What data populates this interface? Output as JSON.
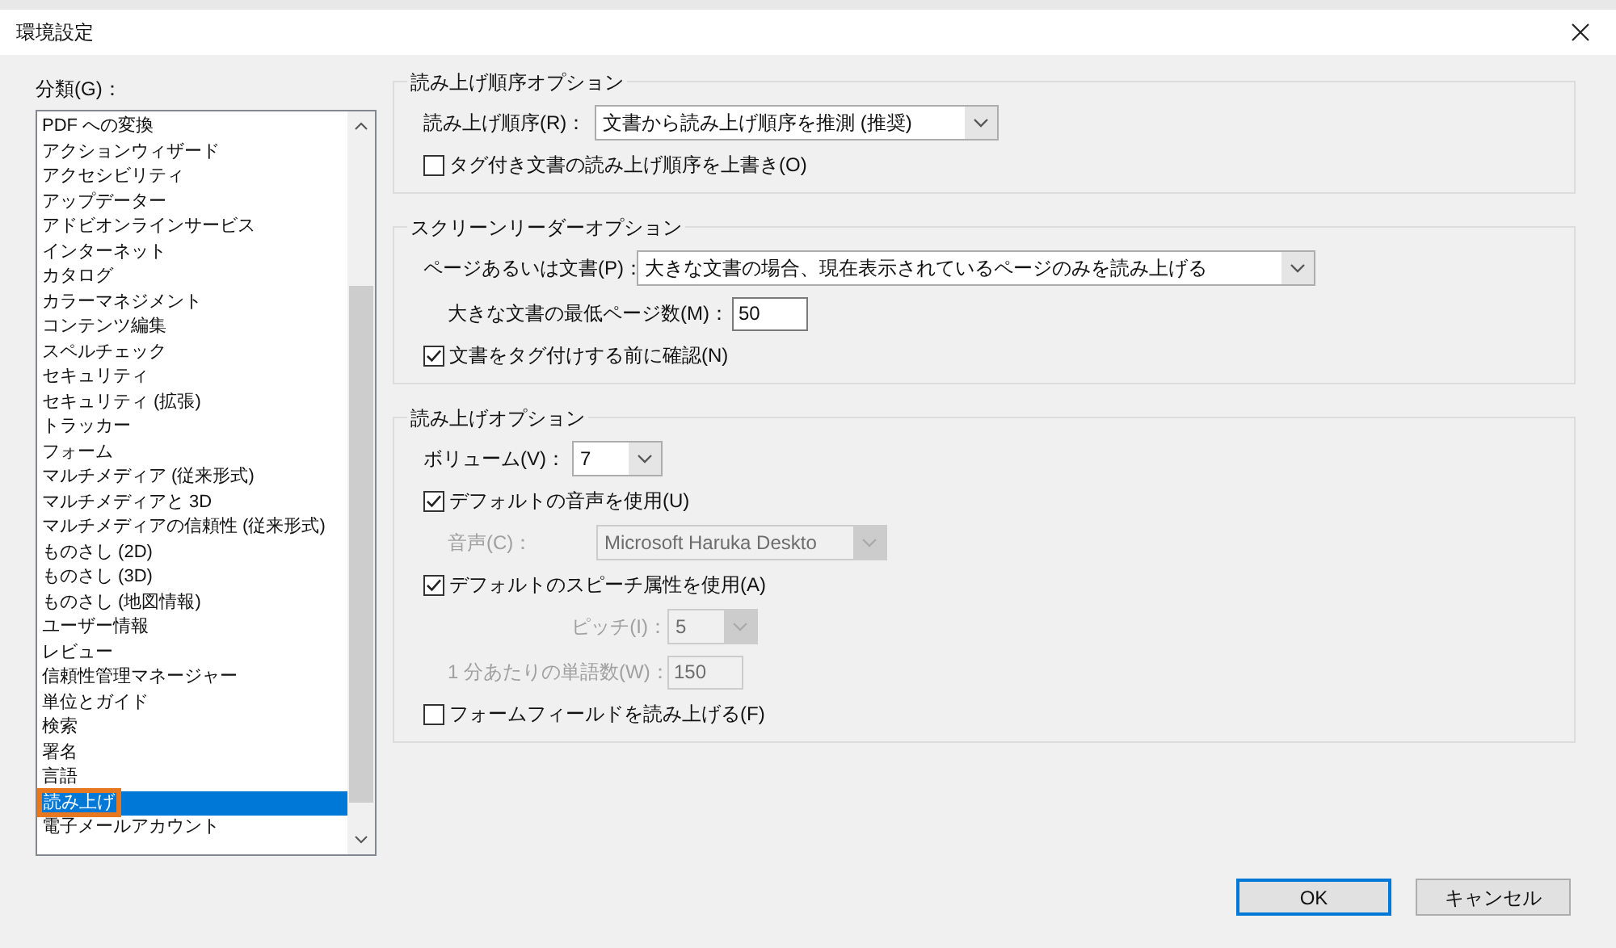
{
  "window": {
    "title": "環境設定"
  },
  "category": {
    "label": "分類(G)：",
    "items": [
      {
        "label": "PDF への変換",
        "selected": false
      },
      {
        "label": "アクションウィザード",
        "selected": false
      },
      {
        "label": "アクセシビリティ",
        "selected": false
      },
      {
        "label": "アップデーター",
        "selected": false
      },
      {
        "label": "アドビオンラインサービス",
        "selected": false
      },
      {
        "label": "インターネット",
        "selected": false
      },
      {
        "label": "カタログ",
        "selected": false
      },
      {
        "label": "カラーマネジメント",
        "selected": false
      },
      {
        "label": "コンテンツ編集",
        "selected": false
      },
      {
        "label": "スペルチェック",
        "selected": false
      },
      {
        "label": "セキュリティ",
        "selected": false
      },
      {
        "label": "セキュリティ (拡張)",
        "selected": false
      },
      {
        "label": "トラッカー",
        "selected": false
      },
      {
        "label": "フォーム",
        "selected": false
      },
      {
        "label": "マルチメディア (従来形式)",
        "selected": false
      },
      {
        "label": "マルチメディアと 3D",
        "selected": false
      },
      {
        "label": "マルチメディアの信頼性 (従来形式)",
        "selected": false
      },
      {
        "label": "ものさし (2D)",
        "selected": false
      },
      {
        "label": "ものさし (3D)",
        "selected": false
      },
      {
        "label": "ものさし (地図情報)",
        "selected": false
      },
      {
        "label": "ユーザー情報",
        "selected": false
      },
      {
        "label": "レビュー",
        "selected": false
      },
      {
        "label": "信頼性管理マネージャー",
        "selected": false
      },
      {
        "label": "単位とガイド",
        "selected": false
      },
      {
        "label": "検索",
        "selected": false
      },
      {
        "label": "署名",
        "selected": false
      },
      {
        "label": "言語",
        "selected": false
      },
      {
        "label": "読み上げ",
        "selected": true
      },
      {
        "label": "電子メールアカウント",
        "selected": false
      }
    ]
  },
  "groups": [
    {
      "title": "読み上げ順序オプション",
      "rows": [
        {
          "kind": "select",
          "label": "読み上げ順序(R)：",
          "value": "文書から読み上げ順序を推測 (推奨)",
          "disabled": false
        },
        {
          "kind": "checkbox",
          "label": "タグ付き文書の読み上げ順序を上書き(O)",
          "checked": false
        }
      ]
    },
    {
      "title": "スクリーンリーダーオプション",
      "rows": [
        {
          "kind": "select",
          "label": "ページあるいは文書(P)：",
          "value": "大きな文書の場合、現在表示されているページのみを読み上げる",
          "disabled": false
        },
        {
          "kind": "field",
          "label": "大きな文書の最低ページ数(M)：",
          "value": "50",
          "disabled": false
        },
        {
          "kind": "checkbox",
          "label": "文書をタグ付けする前に確認(N)",
          "checked": true
        }
      ]
    },
    {
      "title": "読み上げオプション",
      "rows": [
        {
          "kind": "select",
          "label": "ボリューム(V)：",
          "value": "7",
          "disabled": false
        },
        {
          "kind": "checkbox",
          "label": "デフォルトの音声を使用(U)",
          "checked": true
        },
        {
          "kind": "select",
          "label": "音声(C)：",
          "value": "Microsoft Haruka Deskto",
          "disabled": true
        },
        {
          "kind": "checkbox",
          "label": "デフォルトのスピーチ属性を使用(A)",
          "checked": true
        },
        {
          "kind": "select",
          "label": "ピッチ(I)：",
          "value": "5",
          "disabled": true
        },
        {
          "kind": "field",
          "label": "1 分あたりの単語数(W)：",
          "value": "150",
          "disabled": true
        },
        {
          "kind": "checkbox",
          "label": "フォームフィールドを読み上げる(F)",
          "checked": false
        }
      ]
    }
  ],
  "buttons": [
    {
      "label": "OK",
      "selected": true
    },
    {
      "label": "キャンセル",
      "selected": false
    }
  ]
}
